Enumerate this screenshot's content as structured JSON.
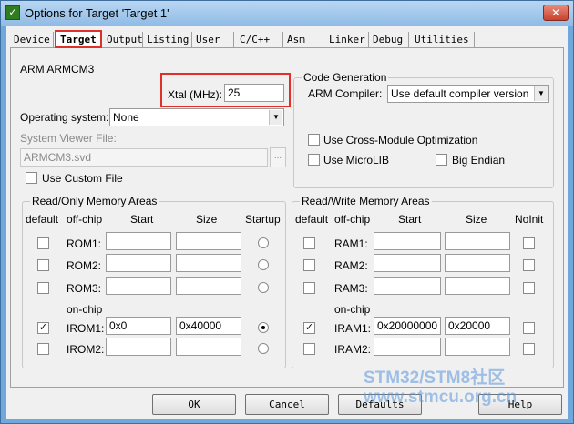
{
  "window": {
    "title": "Options for Target 'Target 1'",
    "close_glyph": "✕",
    "icon_glyph": "✓"
  },
  "tabs": [
    "Device",
    "Target",
    "Output",
    "Listing",
    "User",
    "C/C++",
    "Asm",
    "Linker",
    "Debug",
    "Utilities"
  ],
  "active_tab": "Target",
  "device_name": "ARM ARMCM3",
  "xtal": {
    "label": "Xtal (MHz):",
    "value": "25"
  },
  "os": {
    "label": "Operating system:",
    "value": "None"
  },
  "svd": {
    "label": "System Viewer File:",
    "value": "ARMCM3.svd",
    "browse": "..."
  },
  "custom_file": {
    "label": "Use Custom File",
    "checked": false
  },
  "code_gen": {
    "title": "Code Generation",
    "compiler_label": "ARM Compiler:",
    "compiler_value": "Use default compiler version",
    "cross_module": {
      "label": "Use Cross-Module Optimization",
      "checked": false
    },
    "microlib": {
      "label": "Use MicroLIB",
      "checked": false
    },
    "big_endian": {
      "label": "Big Endian",
      "checked": false
    }
  },
  "rom_group": {
    "title": "Read/Only Memory Areas",
    "headers": {
      "default": "default",
      "offchip": "off-chip",
      "start": "Start",
      "size": "Size",
      "last": "Startup"
    },
    "onchip_label": "on-chip",
    "rows": [
      {
        "name": "ROM1:",
        "start": "",
        "size": "",
        "default": false,
        "selected": false
      },
      {
        "name": "ROM2:",
        "start": "",
        "size": "",
        "default": false,
        "selected": false
      },
      {
        "name": "ROM3:",
        "start": "",
        "size": "",
        "default": false,
        "selected": false
      },
      {
        "name": "IROM1:",
        "start": "0x0",
        "size": "0x40000",
        "default": true,
        "selected": true
      },
      {
        "name": "IROM2:",
        "start": "",
        "size": "",
        "default": false,
        "selected": false
      }
    ]
  },
  "ram_group": {
    "title": "Read/Write Memory Areas",
    "headers": {
      "default": "default",
      "offchip": "off-chip",
      "start": "Start",
      "size": "Size",
      "last": "NoInit"
    },
    "onchip_label": "on-chip",
    "rows": [
      {
        "name": "RAM1:",
        "start": "",
        "size": "",
        "default": false,
        "noinit": false
      },
      {
        "name": "RAM2:",
        "start": "",
        "size": "",
        "default": false,
        "noinit": false
      },
      {
        "name": "RAM3:",
        "start": "",
        "size": "",
        "default": false,
        "noinit": false
      },
      {
        "name": "IRAM1:",
        "start": "0x20000000",
        "size": "0x20000",
        "default": true,
        "noinit": false
      },
      {
        "name": "IRAM2:",
        "start": "",
        "size": "",
        "default": false,
        "noinit": false
      }
    ]
  },
  "buttons": {
    "ok": "OK",
    "cancel": "Cancel",
    "defaults": "Defaults",
    "help": "Help"
  },
  "watermark": {
    "line1": "STM32/STM8社区",
    "line2": "www.stmcu.org.cn"
  },
  "colors": {
    "highlight": "#e0302a",
    "titlebar": "#8fbbe6"
  }
}
